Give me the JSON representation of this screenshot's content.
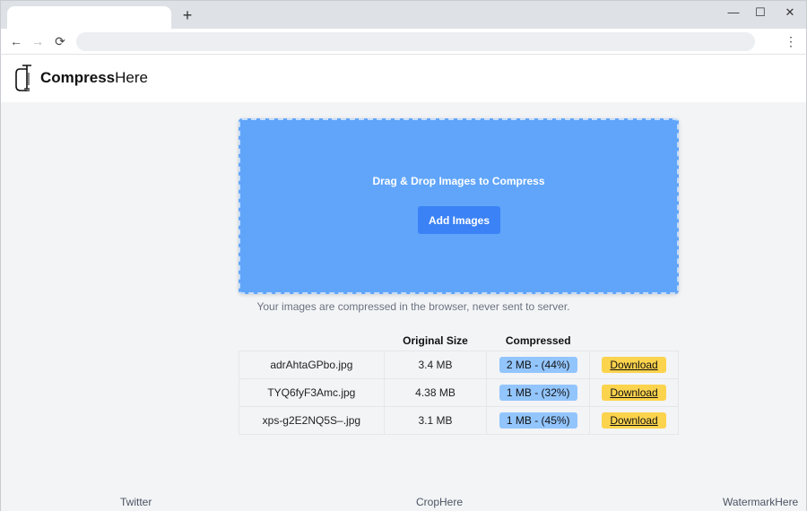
{
  "browser": {
    "new_tab_glyph": "+",
    "minimize_glyph": "—",
    "maximize_glyph": "☐",
    "close_glyph": "✕",
    "back_glyph": "←",
    "forward_glyph": "→",
    "reload_glyph": "⟳",
    "menu_glyph": "⋮",
    "address_value": ""
  },
  "header": {
    "brand_bold": "Compress",
    "brand_regular": "Here",
    "logo_icon": "clamp-icon"
  },
  "dropzone": {
    "title": "Drag & Drop Images to Compress",
    "button_label": "Add Images"
  },
  "note": "Your images are compressed in the browser, never sent to server.",
  "table": {
    "headers": [
      "",
      "Original Size",
      "Compressed",
      ""
    ],
    "rows": [
      {
        "name": "adrAhtaGPbo.jpg",
        "original": "3.4 MB",
        "compressed": "2 MB - (44%)",
        "action": "Download"
      },
      {
        "name": "TYQ6fyF3Amc.jpg",
        "original": "4.38 MB",
        "compressed": "1 MB - (32%)",
        "action": "Download"
      },
      {
        "name": "xps-g2E2NQ5S–.jpg",
        "original": "3.1 MB",
        "compressed": "1 MB - (45%)",
        "action": "Download"
      }
    ]
  },
  "footer": {
    "left": "Twitter",
    "center": "CropHere",
    "right": "WatermarkHere"
  },
  "colors": {
    "dropzone_bg": "#60a5fa",
    "button_bg": "#3b82f6",
    "badge_bg": "#93c5fd",
    "download_bg": "#fcd34d",
    "page_bg": "#f3f4f6"
  }
}
